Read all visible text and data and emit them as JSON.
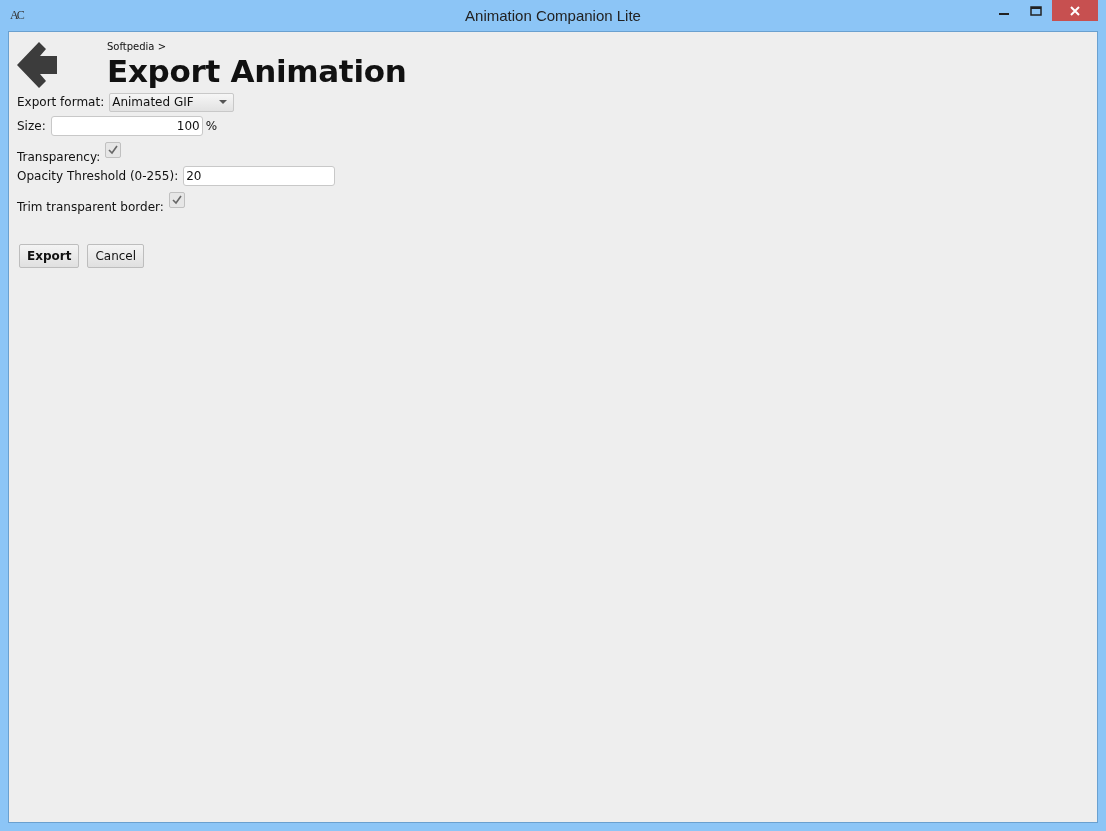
{
  "window": {
    "app_icon": "AC",
    "title": "Animation Companion Lite"
  },
  "header": {
    "breadcrumb": "Softpedia >",
    "title": "Export Animation"
  },
  "form": {
    "export_format": {
      "label": "Export format:",
      "value": "Animated GIF"
    },
    "size": {
      "label": "Size:",
      "value": "100",
      "unit": "%"
    },
    "transparency": {
      "label": "Transparency:",
      "checked": true
    },
    "opacity_threshold": {
      "label": "Opacity Threshold (0-255):",
      "value": "20"
    },
    "trim_border": {
      "label": "Trim transparent border:",
      "checked": true
    }
  },
  "buttons": [
    {
      "label": "Export",
      "default": true
    },
    {
      "label": "Cancel",
      "default": false
    }
  ]
}
